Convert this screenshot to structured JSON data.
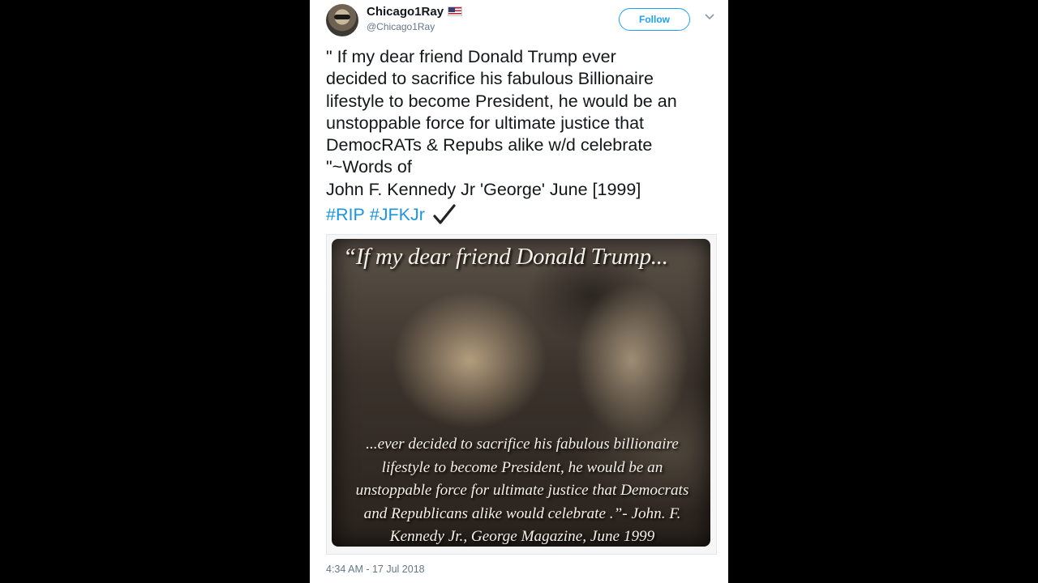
{
  "tweet": {
    "display_name": "Chicago1Ray",
    "handle": "@Chicago1Ray",
    "follow_label": "Follow",
    "text": "\" If my dear friend Donald Trump ever\ndecided to sacrifice his fabulous Billionaire\nlifestyle to become President, he would be an\nunstoppable force for ultimate justice that\nDemocRATs & Repubs alike w/d celebrate\n\"~Words of\nJohn F. Kennedy Jr  'George' June [1999]",
    "hashtags": [
      "#RIP",
      "#JFKJr"
    ],
    "timestamp": "4:34 AM - 17 Jul 2018"
  },
  "media": {
    "headline": "“If my dear friend Donald Trump...",
    "quote": "...ever decided to sacrifice  his fabulous billionaire\nlifestyle to become President, he would be an\nunstoppable force for ultimate justice that Democrats\nand Republicans alike would celebrate .”- John. F.\nKennedy  Jr., George Magazine, June 1999"
  },
  "icons": {
    "flag": "us-flag-icon",
    "caret": "chevron-down-icon",
    "check": "checkmark-icon"
  },
  "colors": {
    "background": "#000000",
    "card": "#ffffff",
    "accent": "#1da1f2",
    "hashtag": "#1b95e0",
    "text": "#14171a",
    "muted": "#657786"
  }
}
